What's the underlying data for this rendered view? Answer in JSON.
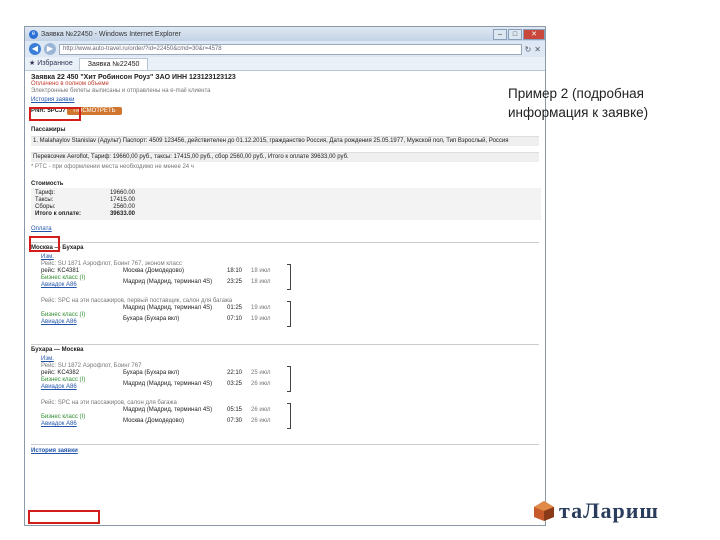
{
  "browser": {
    "title": "Заявка №22450 - Windows Internet Explorer",
    "url": "http://www.auto-travel.ru/order/?id=22450&cmd=30&r=4578",
    "favorites": "Избранное",
    "tab": "Заявка №22450"
  },
  "order": {
    "header": "Заявка 22 450 \"Хит Робинсон Роуз\" ЗАО ИНН 123123123123",
    "status": "Оплачено в полном объеме",
    "note": "Электронные билеты выписаны и отправлены на e-mail клиента",
    "history_link": "История заявки",
    "pnr_label": "PNR: 5PCJ7",
    "pnr_button": "ПОСМОТРЕТЬ"
  },
  "passengers": {
    "title": "Пассажиры",
    "row1": "1. Malahaylov Stanislav (Адульт) Паспорт: 4509 123456, действителен до 01.12.2015, гражданство Россия, Дата рождения 25.05.1977, Мужской пол, Тип Взрослый, Россия",
    "row2": "Перевозчик Aeroflot, Тариф: 19660,00 руб., таксы: 17415,00 руб., сбор 2560,00 руб., Итого к оплате 39633,00 руб.",
    "note": "* PTC - при оформлении места необходимо не менее 24 ч"
  },
  "cost": {
    "title": "Стоимость",
    "rows": [
      {
        "label": "Тариф:",
        "value": "19660.00"
      },
      {
        "label": "Таксы:",
        "value": "17415.00"
      },
      {
        "label": "Сборы:",
        "value": "2560.00"
      },
      {
        "label": "Итого к оплате:",
        "value": "39633.00"
      }
    ],
    "pay_link": "Оплата"
  },
  "route1": {
    "title": "Москва — Бухара",
    "seg1": {
      "head": "Рейс: SU 1871 Аэрофлот, Боинг 767, эконом класс",
      "flight": "рейс: KC4381",
      "class": "Бизнес класс (I)",
      "link": "Авиадок А86",
      "from_city": "Москва (Домодедово)",
      "to_city": "Мадрид (Мадрид, терминал 4S)",
      "time1": "18:10",
      "date1": "18 июл",
      "time2": "23:25",
      "date2": "18 июл"
    },
    "seg2": {
      "head": "Рейс: SPC на эти пассажиров, первый поставщик, салон для багажа",
      "class": "Бизнес класс (I)",
      "link": "Авиадок А86",
      "from_city": "Мадрид (Мадрид, терминал 4S)",
      "to_city": "Бухара (Бухара вкл)",
      "time1": "01:25",
      "date1": "19 июл",
      "time2": "07:10",
      "date2": "19 июл"
    }
  },
  "route2": {
    "title": "Бухара — Москва",
    "seg1": {
      "head": "Рейс: SU 1872 Аэрофлот, Боинг 767",
      "flight": "рейс: KC4382",
      "class": "Бизнес класс (I)",
      "link": "Авиадок А86",
      "from_city": "Бухара (Бухара вкл)",
      "to_city": "Мадрид (Мадрид, терминал 4S)",
      "time1": "22:10",
      "date1": "25 июл",
      "time2": "03:25",
      "date2": "26 июл"
    },
    "seg2": {
      "head": "Рейс: SPC на эти пассажиров, салон для багажа",
      "class": "Бизнес класс (I)",
      "link": "Авиадок А86",
      "from_city": "Мадрид (Мадрид, терминал 4S)",
      "to_city": "Москва (Домодедово)",
      "time1": "05:15",
      "date1": "26 июл",
      "time2": "07:30",
      "date2": "26 июл"
    }
  },
  "footer": {
    "history": "История заявки"
  },
  "caption": "Пример 2 (подробная информация к заявке)",
  "logo": "таЛариш",
  "colors": {
    "highlight": "#d21d1d",
    "orange_button": "#d0762e",
    "link": "#2255aa",
    "logo_text": "#2a3d5c"
  }
}
